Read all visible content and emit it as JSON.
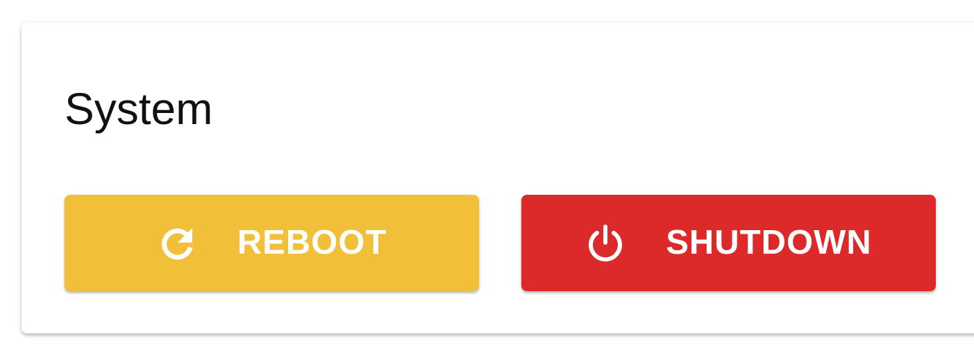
{
  "card": {
    "title": "System"
  },
  "buttons": {
    "reboot": {
      "label": "REBOOT",
      "icon": "refresh-icon",
      "color": "#F2BF38"
    },
    "shutdown": {
      "label": "SHUTDOWN",
      "icon": "power-icon",
      "color": "#DC2A2A"
    }
  }
}
